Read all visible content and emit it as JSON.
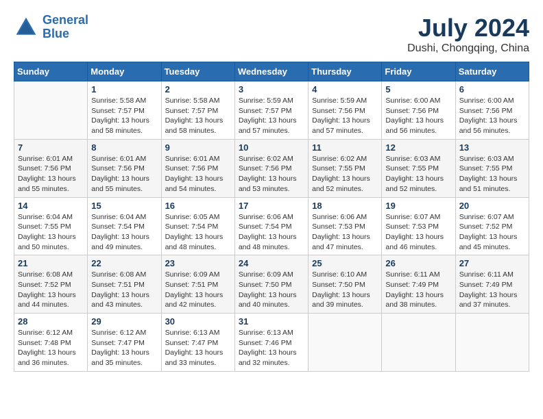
{
  "header": {
    "logo_line1": "General",
    "logo_line2": "Blue",
    "month_year": "July 2024",
    "location": "Dushi, Chongqing, China"
  },
  "weekdays": [
    "Sunday",
    "Monday",
    "Tuesday",
    "Wednesday",
    "Thursday",
    "Friday",
    "Saturday"
  ],
  "weeks": [
    [
      {
        "day": "",
        "info": ""
      },
      {
        "day": "1",
        "info": "Sunrise: 5:58 AM\nSunset: 7:57 PM\nDaylight: 13 hours\nand 58 minutes."
      },
      {
        "day": "2",
        "info": "Sunrise: 5:58 AM\nSunset: 7:57 PM\nDaylight: 13 hours\nand 58 minutes."
      },
      {
        "day": "3",
        "info": "Sunrise: 5:59 AM\nSunset: 7:57 PM\nDaylight: 13 hours\nand 57 minutes."
      },
      {
        "day": "4",
        "info": "Sunrise: 5:59 AM\nSunset: 7:56 PM\nDaylight: 13 hours\nand 57 minutes."
      },
      {
        "day": "5",
        "info": "Sunrise: 6:00 AM\nSunset: 7:56 PM\nDaylight: 13 hours\nand 56 minutes."
      },
      {
        "day": "6",
        "info": "Sunrise: 6:00 AM\nSunset: 7:56 PM\nDaylight: 13 hours\nand 56 minutes."
      }
    ],
    [
      {
        "day": "7",
        "info": "Sunrise: 6:01 AM\nSunset: 7:56 PM\nDaylight: 13 hours\nand 55 minutes."
      },
      {
        "day": "8",
        "info": "Sunrise: 6:01 AM\nSunset: 7:56 PM\nDaylight: 13 hours\nand 55 minutes."
      },
      {
        "day": "9",
        "info": "Sunrise: 6:01 AM\nSunset: 7:56 PM\nDaylight: 13 hours\nand 54 minutes."
      },
      {
        "day": "10",
        "info": "Sunrise: 6:02 AM\nSunset: 7:56 PM\nDaylight: 13 hours\nand 53 minutes."
      },
      {
        "day": "11",
        "info": "Sunrise: 6:02 AM\nSunset: 7:55 PM\nDaylight: 13 hours\nand 52 minutes."
      },
      {
        "day": "12",
        "info": "Sunrise: 6:03 AM\nSunset: 7:55 PM\nDaylight: 13 hours\nand 52 minutes."
      },
      {
        "day": "13",
        "info": "Sunrise: 6:03 AM\nSunset: 7:55 PM\nDaylight: 13 hours\nand 51 minutes."
      }
    ],
    [
      {
        "day": "14",
        "info": "Sunrise: 6:04 AM\nSunset: 7:55 PM\nDaylight: 13 hours\nand 50 minutes."
      },
      {
        "day": "15",
        "info": "Sunrise: 6:04 AM\nSunset: 7:54 PM\nDaylight: 13 hours\nand 49 minutes."
      },
      {
        "day": "16",
        "info": "Sunrise: 6:05 AM\nSunset: 7:54 PM\nDaylight: 13 hours\nand 48 minutes."
      },
      {
        "day": "17",
        "info": "Sunrise: 6:06 AM\nSunset: 7:54 PM\nDaylight: 13 hours\nand 48 minutes."
      },
      {
        "day": "18",
        "info": "Sunrise: 6:06 AM\nSunset: 7:53 PM\nDaylight: 13 hours\nand 47 minutes."
      },
      {
        "day": "19",
        "info": "Sunrise: 6:07 AM\nSunset: 7:53 PM\nDaylight: 13 hours\nand 46 minutes."
      },
      {
        "day": "20",
        "info": "Sunrise: 6:07 AM\nSunset: 7:52 PM\nDaylight: 13 hours\nand 45 minutes."
      }
    ],
    [
      {
        "day": "21",
        "info": "Sunrise: 6:08 AM\nSunset: 7:52 PM\nDaylight: 13 hours\nand 44 minutes."
      },
      {
        "day": "22",
        "info": "Sunrise: 6:08 AM\nSunset: 7:51 PM\nDaylight: 13 hours\nand 43 minutes."
      },
      {
        "day": "23",
        "info": "Sunrise: 6:09 AM\nSunset: 7:51 PM\nDaylight: 13 hours\nand 42 minutes."
      },
      {
        "day": "24",
        "info": "Sunrise: 6:09 AM\nSunset: 7:50 PM\nDaylight: 13 hours\nand 40 minutes."
      },
      {
        "day": "25",
        "info": "Sunrise: 6:10 AM\nSunset: 7:50 PM\nDaylight: 13 hours\nand 39 minutes."
      },
      {
        "day": "26",
        "info": "Sunrise: 6:11 AM\nSunset: 7:49 PM\nDaylight: 13 hours\nand 38 minutes."
      },
      {
        "day": "27",
        "info": "Sunrise: 6:11 AM\nSunset: 7:49 PM\nDaylight: 13 hours\nand 37 minutes."
      }
    ],
    [
      {
        "day": "28",
        "info": "Sunrise: 6:12 AM\nSunset: 7:48 PM\nDaylight: 13 hours\nand 36 minutes."
      },
      {
        "day": "29",
        "info": "Sunrise: 6:12 AM\nSunset: 7:47 PM\nDaylight: 13 hours\nand 35 minutes."
      },
      {
        "day": "30",
        "info": "Sunrise: 6:13 AM\nSunset: 7:47 PM\nDaylight: 13 hours\nand 33 minutes."
      },
      {
        "day": "31",
        "info": "Sunrise: 6:13 AM\nSunset: 7:46 PM\nDaylight: 13 hours\nand 32 minutes."
      },
      {
        "day": "",
        "info": ""
      },
      {
        "day": "",
        "info": ""
      },
      {
        "day": "",
        "info": ""
      }
    ]
  ]
}
